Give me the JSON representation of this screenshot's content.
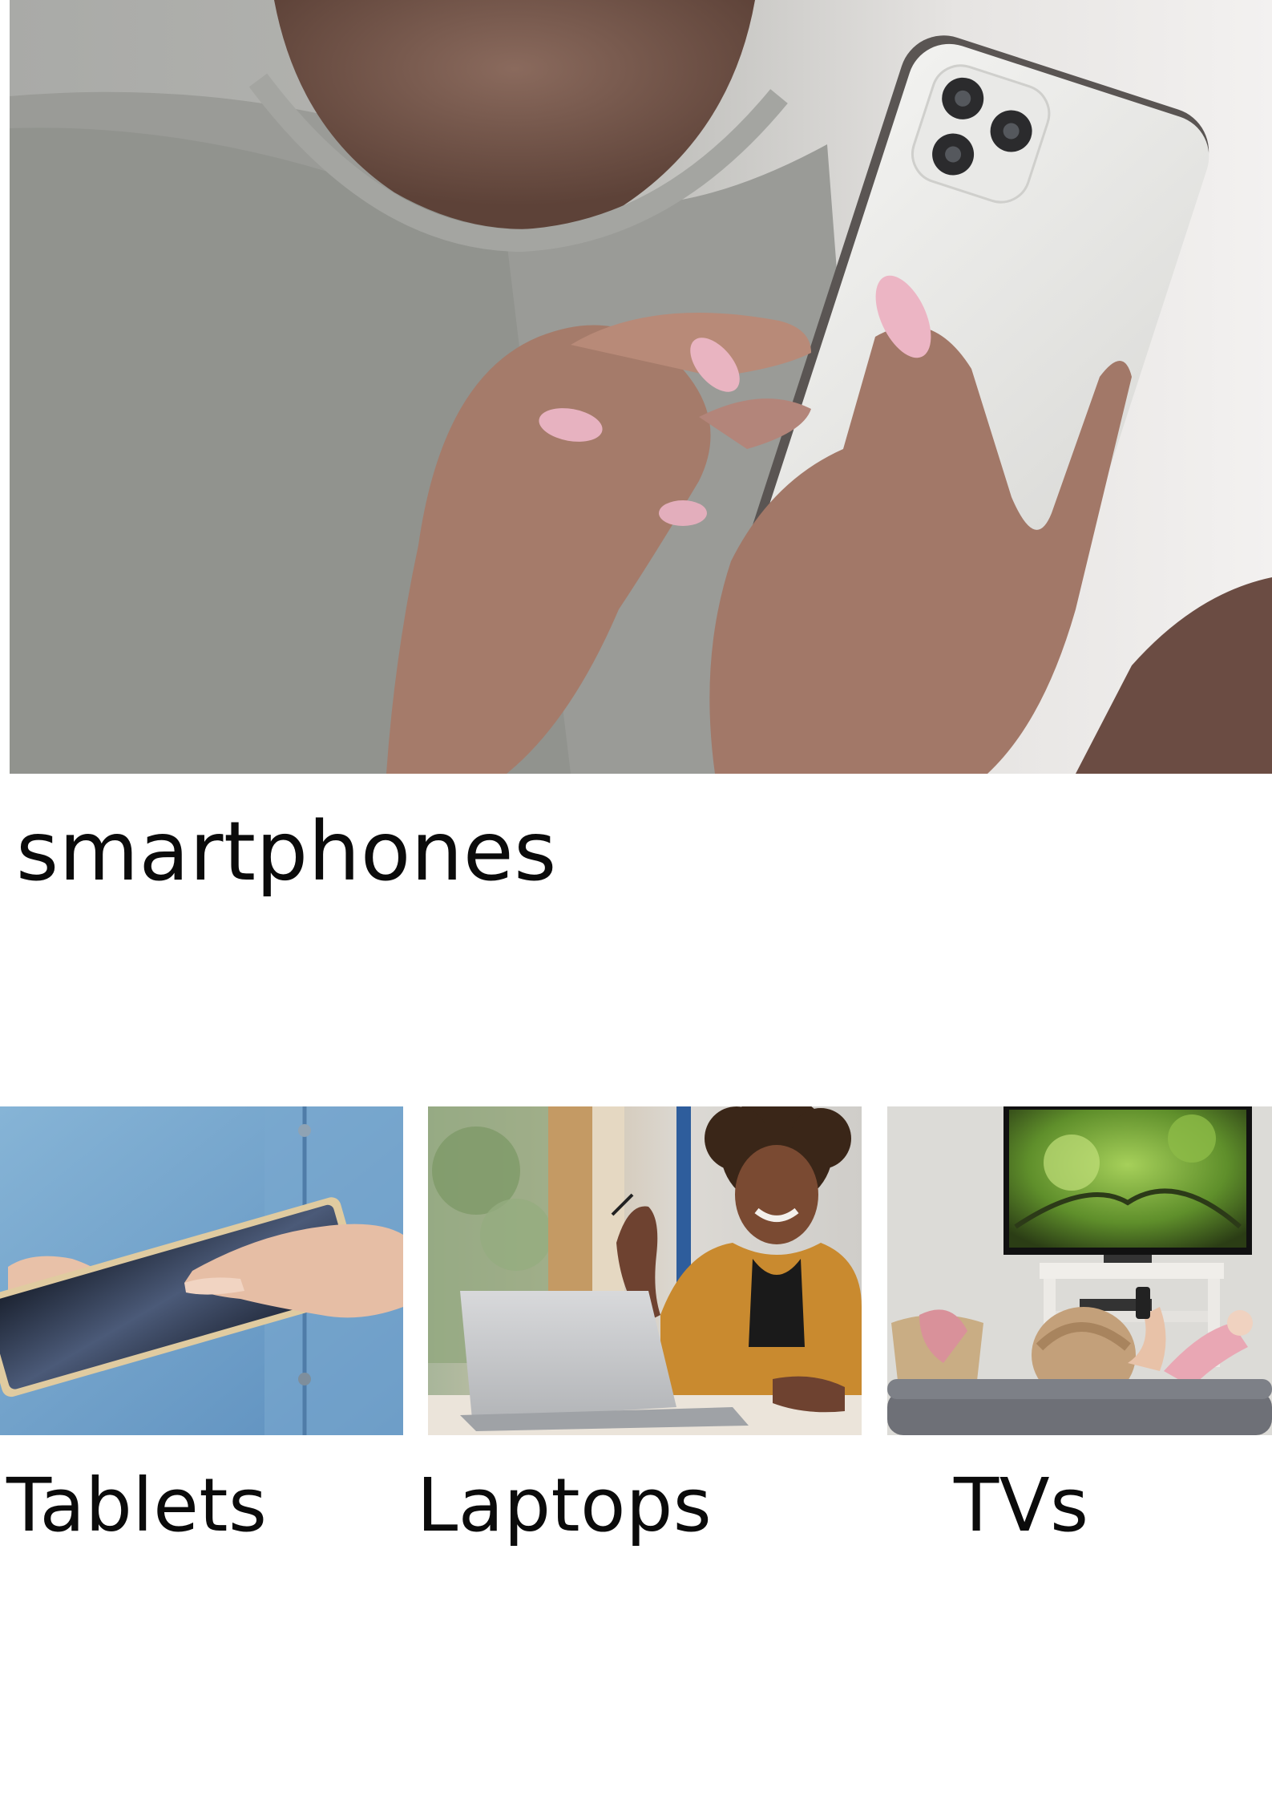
{
  "hero": {
    "label": "smartphones",
    "image": "woman-holding-smartphone-photo"
  },
  "categories": [
    {
      "label": "Tablets",
      "image": "hands-using-tablet-photo"
    },
    {
      "label": "Laptops",
      "image": "woman-smiling-at-laptop-photo"
    },
    {
      "label": "TVs",
      "image": "person-watching-tv-photo"
    }
  ]
}
